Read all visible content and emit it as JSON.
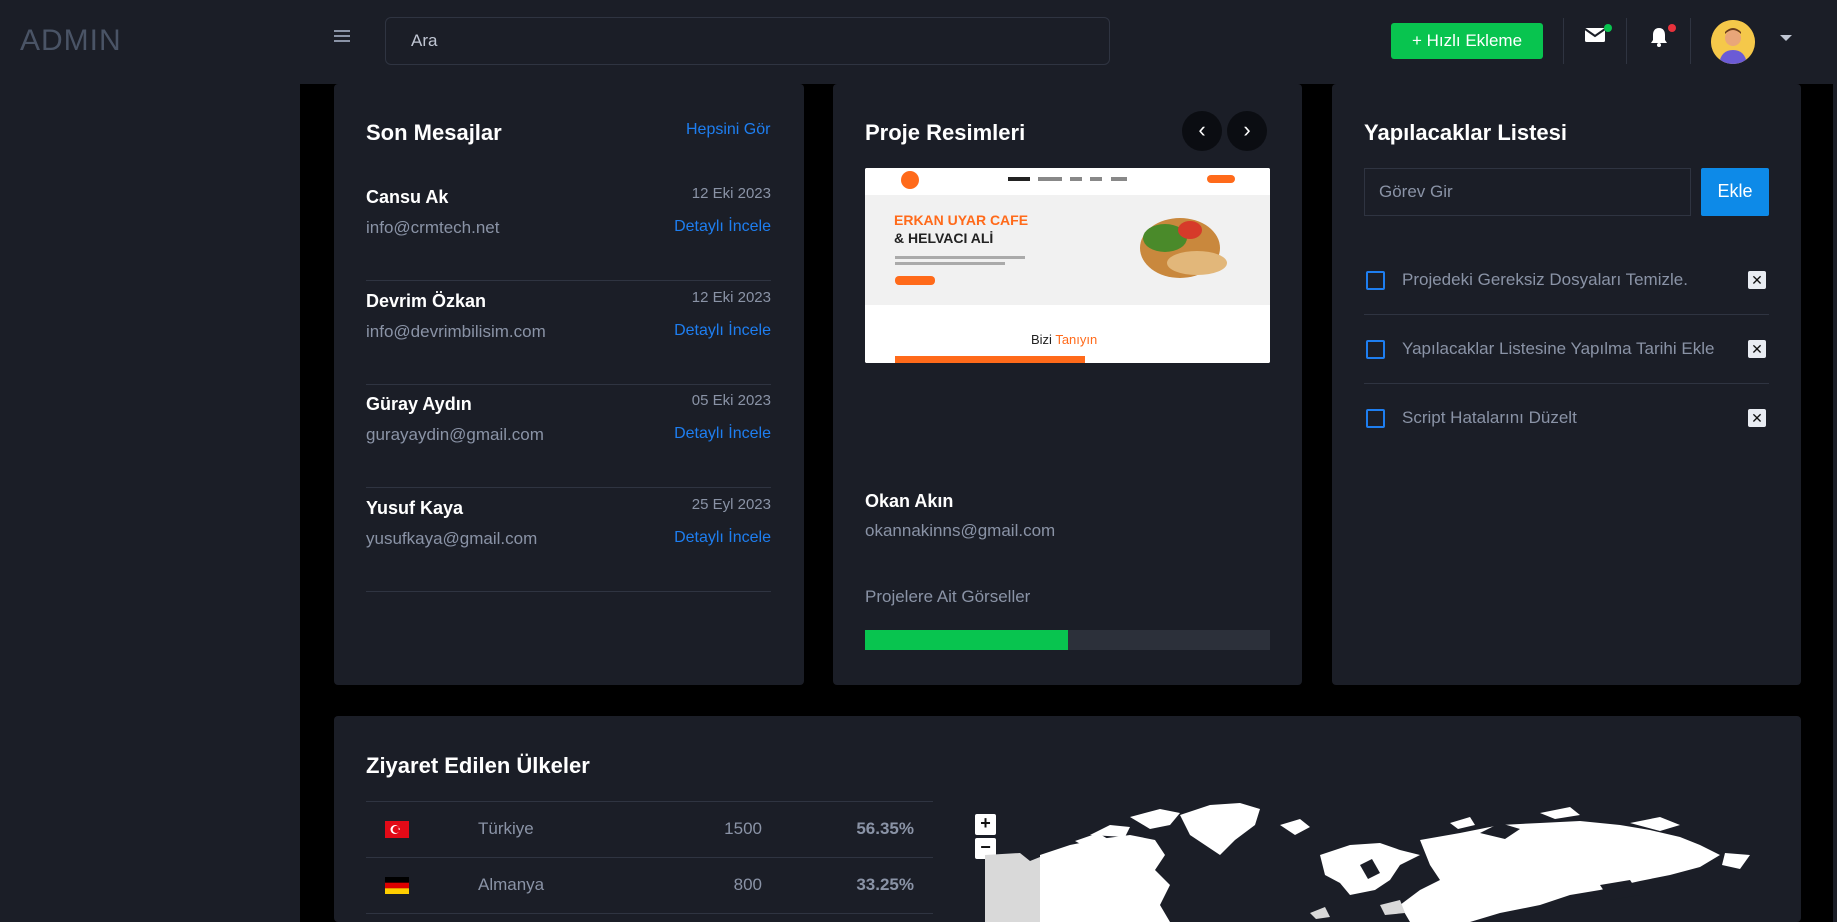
{
  "header": {
    "logo": "ADMIN",
    "search_placeholder": "Ara",
    "quick_add_label": "+ Hızlı Ekleme",
    "colors": {
      "accent_green": "#08c44f",
      "accent_blue": "#1e7ef0",
      "mail_dot": "#08c44f",
      "bell_dot": "#e8323c"
    }
  },
  "messages": {
    "title": "Son Mesajlar",
    "see_all": "Hepsini Gör",
    "items": [
      {
        "name": "Cansu Ak",
        "email": "info@crmtech.net",
        "date": "12 Eki 2023",
        "detail": "Detaylı İncele"
      },
      {
        "name": "Devrim Özkan",
        "email": "info@devrimbilisim.com",
        "date": "12 Eki 2023",
        "detail": "Detaylı İncele"
      },
      {
        "name": "Güray Aydın",
        "email": "gurayaydin@gmail.com",
        "date": "05 Eki 2023",
        "detail": "Detaylı İncele"
      },
      {
        "name": "Yusuf Kaya",
        "email": "yusufkaya@gmail.com",
        "date": "25 Eyl 2023",
        "detail": "Detaylı İncele"
      }
    ]
  },
  "projects": {
    "title": "Proje Resimleri",
    "prev_icon": "chevron-left-icon",
    "next_icon": "chevron-right-icon",
    "screenshot": {
      "headline1": "ERKAN UYAR CAFE",
      "headline2": "& HELVACI ALİ",
      "section_part1": "Bizi ",
      "section_part2": "Tanıyın"
    },
    "person_name": "Okan Akın",
    "person_email": "okannakinns@gmail.com",
    "caption": "Projelere Ait Görseller",
    "progress": 0.5
  },
  "todo": {
    "title": "Yapılacaklar Listesi",
    "input_placeholder": "Görev Gir",
    "add_label": "Ekle",
    "items": [
      {
        "text": "Projedeki Gereksiz Dosyaları Temizle.",
        "done": false
      },
      {
        "text": "Yapılacaklar Listesine Yapılma Tarihi Ekle",
        "done": false
      },
      {
        "text": "Script Hatalarını Düzelt",
        "done": false
      }
    ]
  },
  "countries": {
    "title": "Ziyaret Edilen Ülkeler",
    "rows": [
      {
        "flag": "turkey-flag-icon",
        "name": "Türkiye",
        "count": "1500",
        "percent": "56.35%"
      },
      {
        "flag": "germany-flag-icon",
        "name": "Almanya",
        "count": "800",
        "percent": "33.25%"
      }
    ],
    "zoom_in": "+",
    "zoom_out": "−"
  }
}
